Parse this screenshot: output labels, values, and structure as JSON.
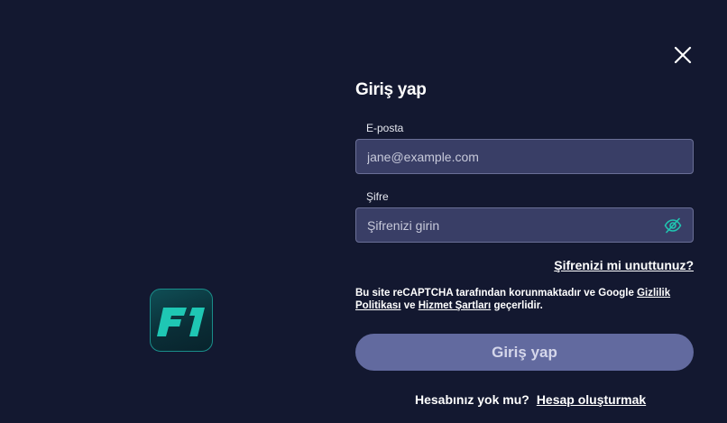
{
  "logo": {
    "text": "F1",
    "accent": "#1fc7b4"
  },
  "close": {
    "icon": "close-icon"
  },
  "form": {
    "title": "Giriş yap",
    "email_label": "E-posta",
    "email_placeholder": "jane@example.com",
    "password_label": "Şifre",
    "password_placeholder": "Şifrenizi girin",
    "forgot_link": "Şifrenizi mi unuttunuz?",
    "recaptcha_prefix": "Bu site reCAPTCHA tarafından korunmaktadır ve Google",
    "privacy_link": "Gizlilik Politikası",
    "recaptcha_and": "ve",
    "terms_link": "Hizmet Şartları",
    "recaptcha_suffix": "geçerlidir.",
    "submit_label": "Giriş yap",
    "no_account_text": "Hesabınız yok mu?",
    "signup_link": "Hesap oluşturmak"
  },
  "colors": {
    "background": "#131830",
    "input_bg": "#393e66",
    "input_border": "#6a6f96",
    "button_bg": "#626a9f",
    "eye_icon": "#20c4b0"
  }
}
